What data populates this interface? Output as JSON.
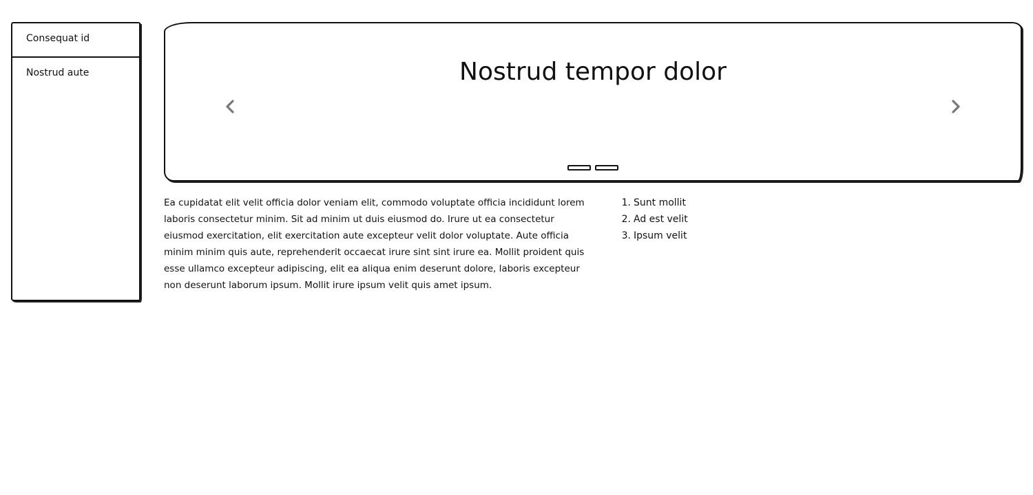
{
  "sidebar": {
    "items": [
      {
        "label": "Consequat id"
      },
      {
        "label": "Nostrud aute"
      }
    ]
  },
  "carousel": {
    "title": "Nostrud tempor dolor",
    "prev_icon": "chevron-left-icon",
    "next_icon": "chevron-right-icon",
    "indicator_count": 2,
    "active_index": 0,
    "arrow_color": "#777777"
  },
  "content": {
    "paragraph": "Ea cupidatat elit velit officia dolor veniam elit, commodo voluptate officia incididunt lorem laboris consectetur minim. Sit ad minim ut duis eiusmod do. Irure ut ea consectetur eiusmod exercitation, elit exercitation aute excepteur velit dolor voluptate. Aute officia minim minim quis aute, reprehenderit occaecat irure sint sint irure ea. Mollit proident quis esse ullamco excepteur adipiscing, elit ea aliqua enim deserunt dolore, laboris excepteur non deserunt laborum ipsum. Mollit irure ipsum velit quis amet ipsum.",
    "list": [
      {
        "num": "1.",
        "text": "Sunt mollit"
      },
      {
        "num": "2.",
        "text": "Ad est velit"
      },
      {
        "num": "3.",
        "text": "Ipsum velit"
      }
    ]
  }
}
